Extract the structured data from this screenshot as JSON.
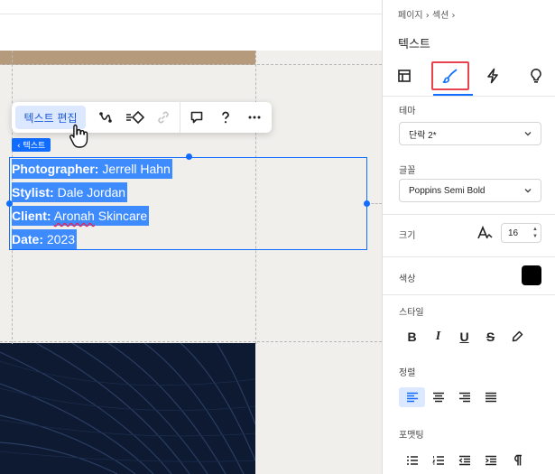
{
  "canvas": {
    "edit_text_label": "텍스트 편집",
    "element_tag": "‹ 텍스트",
    "text_lines": [
      {
        "label": "Photographer:",
        "value": " Jerrell Hahn"
      },
      {
        "label": "Stylist:",
        "value": " Dale Jordan"
      },
      {
        "label": "Client:",
        "value_pre": " ",
        "value_squiggle": "Aronah",
        "value_post": " Skincare"
      },
      {
        "label": "Date:",
        "value": " 2023"
      }
    ],
    "colors": {
      "selection": "#3d8bfd",
      "accent": "#116dff",
      "tan": "#b59a7c",
      "dark_image": "#0d1a31"
    }
  },
  "toolbar_icons": [
    "edit-text",
    "animation-icon",
    "design-icon",
    "link-icon",
    "comment-icon",
    "help-icon",
    "more-icon"
  ],
  "panel": {
    "breadcrumb": "페이지  ›  섹션  ›",
    "title": "텍스트",
    "theme_label": "테마",
    "theme_value": "단락 2*",
    "font_label": "글꼴",
    "font_value": "Poppins Semi Bold",
    "size_label": "크기",
    "size_value": "16",
    "color_label": "색상",
    "color_value": "#000000",
    "style_label": "스타일",
    "align_label": "정렬",
    "format_label": "포맷팅",
    "style_buttons": [
      "B",
      "I",
      "U",
      "S"
    ]
  }
}
